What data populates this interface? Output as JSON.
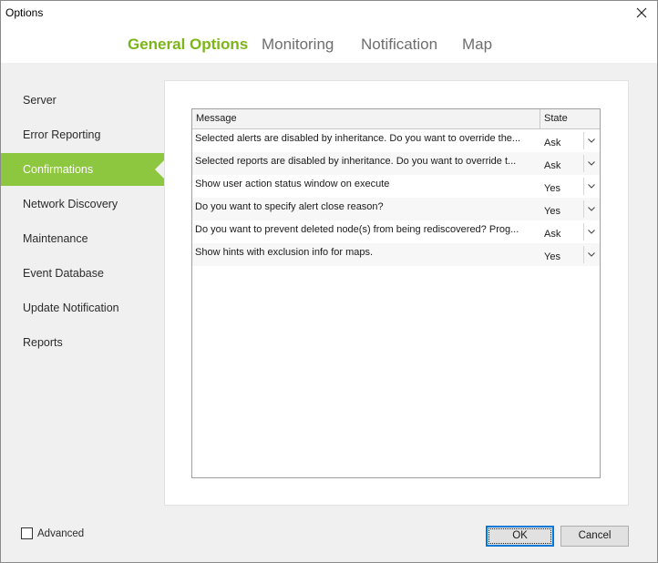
{
  "window": {
    "title": "Options"
  },
  "tabs": [
    {
      "label": "General Options",
      "active": true
    },
    {
      "label": "Monitoring",
      "active": false
    },
    {
      "label": "Notification",
      "active": false
    },
    {
      "label": "Map",
      "active": false
    }
  ],
  "sidebar": {
    "items": [
      {
        "label": "Server",
        "active": false
      },
      {
        "label": "Error Reporting",
        "active": false
      },
      {
        "label": "Confirmations",
        "active": true
      },
      {
        "label": "Network Discovery",
        "active": false
      },
      {
        "label": "Maintenance",
        "active": false
      },
      {
        "label": "Event Database",
        "active": false
      },
      {
        "label": "Update Notification",
        "active": false
      },
      {
        "label": "Reports",
        "active": false
      }
    ]
  },
  "grid": {
    "columns": {
      "message": "Message",
      "state": "State"
    },
    "rows": [
      {
        "message": "Selected alerts are disabled by inheritance. Do you want to override the...",
        "state": "Ask"
      },
      {
        "message": "Selected reports are disabled by inheritance. Do you want to override t...",
        "state": "Ask"
      },
      {
        "message": "Show user action status window on execute",
        "state": "Yes"
      },
      {
        "message": "Do you want to specify alert close reason?",
        "state": "Yes"
      },
      {
        "message": "Do you want to prevent deleted node(s) from being rediscovered? Prog...",
        "state": "Ask"
      },
      {
        "message": "Show hints with exclusion info for maps.",
        "state": "Yes"
      }
    ]
  },
  "footer": {
    "advanced_label": "Advanced",
    "advanced_checked": false,
    "ok_label": "OK",
    "cancel_label": "Cancel"
  },
  "colors": {
    "accent": "#8dc63f",
    "active_tab": "#7cb518",
    "inactive_tab": "#6e6e6e",
    "sidebar_bg": "#f0f0f0"
  }
}
